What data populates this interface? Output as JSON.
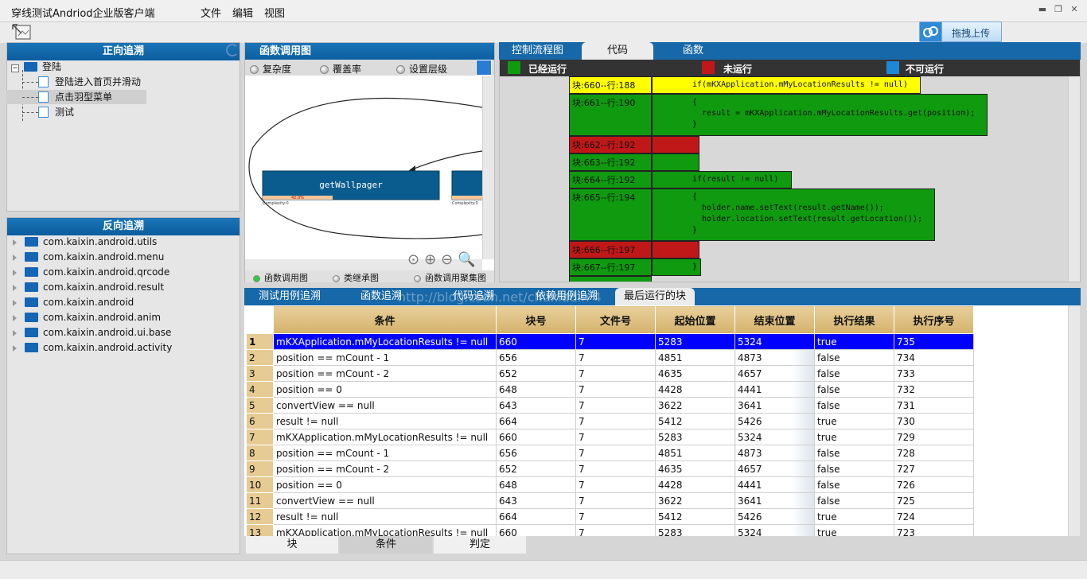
{
  "app": {
    "title": "穿线测试Andriod企业版客户端"
  },
  "menus": [
    "文件",
    "编辑",
    "视图"
  ],
  "toolbar": {
    "upload_label": "拖拽上传"
  },
  "forward": {
    "title": "正向追溯",
    "root": "登陆",
    "children": [
      "登陆进入首页并滑动",
      "点击羽型菜单",
      "测试"
    ]
  },
  "reverse": {
    "title": "反向追溯",
    "items": [
      "com.kaixin.android.utils",
      "com.kaixin.android.menu",
      "com.kaixin.android.qrcode",
      "com.kaixin.android.result",
      "com.kaixin.android",
      "com.kaixin.android.anim",
      "com.kaixin.android.ui.base",
      "com.kaixin.android.activity"
    ]
  },
  "callgraph": {
    "title": "函数调用图",
    "options": [
      "复杂度",
      "覆盖率",
      "设置层级"
    ],
    "node1": "getWallpager",
    "node_caption": "Complexity:0",
    "node_bar": "42.0%",
    "bottom_tabs": [
      "函数调用图",
      "类继承图",
      "函数调用聚集图"
    ]
  },
  "codeview": {
    "tabs": [
      "控制流程图",
      "代码",
      "函数"
    ],
    "legend": [
      {
        "label": "已经运行",
        "color": "#0f9a0f"
      },
      {
        "label": "未运行",
        "color": "#c01818"
      },
      {
        "label": "不可运行",
        "color": "#1e88d8"
      }
    ],
    "blocks": [
      {
        "label": "块:660--行:188",
        "code": "if(mKXApplication.mMyLocationResults != null)",
        "color": "#ffff00"
      },
      {
        "label": "块:661--行:190",
        "code": "{\n  result = mKXApplication.mMyLocationResults.get(position);\n}",
        "color": "#0f9a0f"
      },
      {
        "label": "块:662--行:192",
        "code": "",
        "color": "#c01818"
      },
      {
        "label": "块:663--行:192",
        "code": "",
        "color": "#0f9a0f"
      },
      {
        "label": "块:664--行:192",
        "code": "if(result != null)",
        "color": "#0f9a0f"
      },
      {
        "label": "块:665--行:194",
        "code": "{\n  holder.name.setText(result.getName());\n  holder.location.setText(result.getLocation());\n}",
        "color": "#0f9a0f"
      },
      {
        "label": "块:666--行:197",
        "code": "",
        "color": "#c01818"
      },
      {
        "label": "块:667--行:197",
        "code": "}",
        "color": "#0f9a0f"
      }
    ]
  },
  "lower": {
    "tabs": [
      "测试用例追溯",
      "函数追溯",
      "代码追溯",
      "依赖用例追溯",
      "最后运行的块"
    ],
    "watermark": "http://blog.csdn.net/chuxiadin 4",
    "columns": [
      "条件",
      "块号",
      "文件号",
      "起始位置",
      "结束位置",
      "执行结果",
      "执行序号"
    ],
    "rows": [
      [
        "1",
        "mKXApplication.mMyLocationResults != null",
        "660",
        "7",
        "5283",
        "5324",
        "true",
        "735"
      ],
      [
        "2",
        "position == mCount - 1",
        "656",
        "7",
        "4851",
        "4873",
        "false",
        "734"
      ],
      [
        "3",
        "position == mCount - 2",
        "652",
        "7",
        "4635",
        "4657",
        "false",
        "733"
      ],
      [
        "4",
        "position == 0",
        "648",
        "7",
        "4428",
        "4441",
        "false",
        "732"
      ],
      [
        "5",
        "convertView == null",
        "643",
        "7",
        "3622",
        "3641",
        "false",
        "731"
      ],
      [
        "6",
        "result != null",
        "664",
        "7",
        "5412",
        "5426",
        "true",
        "730"
      ],
      [
        "7",
        "mKXApplication.mMyLocationResults != null",
        "660",
        "7",
        "5283",
        "5324",
        "true",
        "729"
      ],
      [
        "8",
        "position == mCount - 1",
        "656",
        "7",
        "4851",
        "4873",
        "false",
        "728"
      ],
      [
        "9",
        "position == mCount - 2",
        "652",
        "7",
        "4635",
        "4657",
        "false",
        "727"
      ],
      [
        "10",
        "position == 0",
        "648",
        "7",
        "4428",
        "4441",
        "false",
        "726"
      ],
      [
        "11",
        "convertView == null",
        "643",
        "7",
        "3622",
        "3641",
        "false",
        "725"
      ],
      [
        "12",
        "result != null",
        "664",
        "7",
        "5412",
        "5426",
        "true",
        "724"
      ],
      [
        "13",
        "mKXApplication.mMyLocationResults != null",
        "660",
        "7",
        "5283",
        "5324",
        "true",
        "723"
      ]
    ],
    "bottom_tabs": [
      "块",
      "条件",
      "判定"
    ]
  }
}
